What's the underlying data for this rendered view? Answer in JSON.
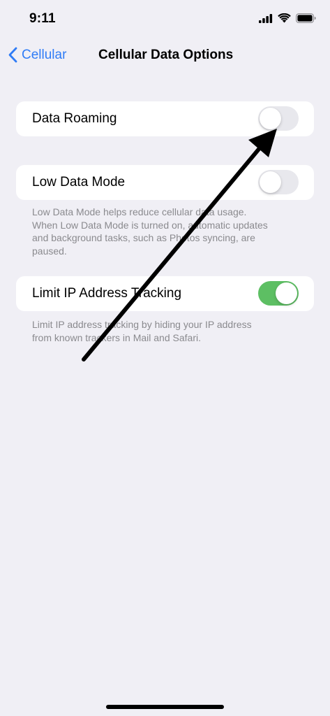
{
  "status_bar": {
    "time": "9:11",
    "icons": [
      "signal-icon",
      "wifi-icon",
      "battery-icon"
    ]
  },
  "nav": {
    "back_label": "Cellular",
    "title": "Cellular Data Options"
  },
  "settings": {
    "data_roaming": {
      "label": "Data Roaming",
      "enabled": false
    },
    "low_data_mode": {
      "label": "Low Data Mode",
      "enabled": false,
      "footer_lines": [
        "Low Data Mode helps reduce cellular data usage.",
        "When Low Data Mode is turned on, automatic updates",
        "and background tasks, such as Photos syncing, are",
        "paused."
      ]
    },
    "limit_ip_tracking": {
      "label": "Limit IP Address Tracking",
      "enabled": true,
      "footer_lines": [
        "Limit IP address tracking by hiding your IP address",
        "from known trackers in Mail and Safari."
      ]
    }
  },
  "colors": {
    "background": "#f0eff5",
    "accent": "#2f7cf6",
    "toggle_on": "#5dbf63",
    "toggle_off": "#e8e8ed",
    "footer_text": "#8a8a8e",
    "annotation_arrow": "#000000"
  }
}
